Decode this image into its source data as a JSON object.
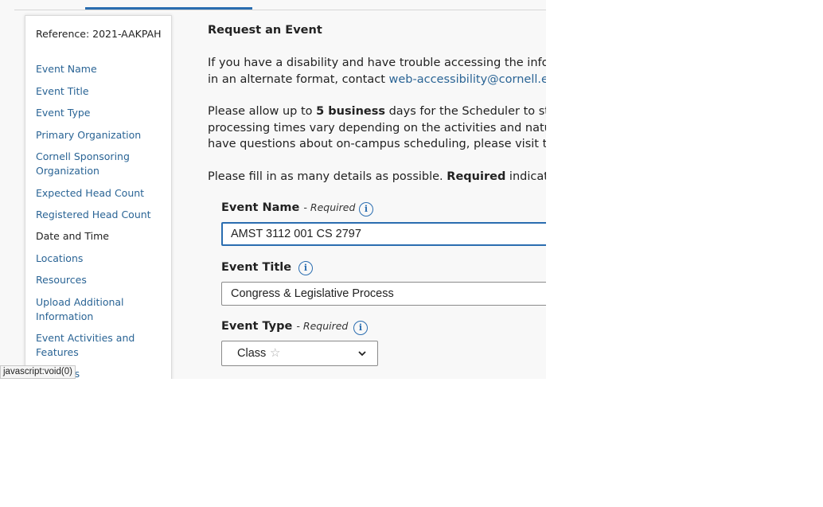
{
  "sidebar": {
    "reference": "Reference: 2021-AAKPAH",
    "items": [
      {
        "label": "Event Name"
      },
      {
        "label": "Event Title"
      },
      {
        "label": "Event Type"
      },
      {
        "label": "Primary Organization"
      },
      {
        "label": "Cornell Sponsoring Organization"
      },
      {
        "label": "Expected Head Count"
      },
      {
        "label": "Registered Head Count"
      },
      {
        "label": "Date and Time"
      },
      {
        "label": "Locations"
      },
      {
        "label": "Resources"
      },
      {
        "label": "Upload Additional Information"
      },
      {
        "label": "Event Activities and Features"
      },
      {
        "label": "Contacts"
      }
    ],
    "current_item": "Date and Time"
  },
  "main": {
    "heading": "Request an Event",
    "accessibility": {
      "line1": "If you have a disability and have trouble accessing the inform",
      "line2_prefix": "in an alternate format, contact ",
      "email_link": "web-accessibility@cornell.edu"
    },
    "processing": {
      "line1_prefix": "Please allow up to ",
      "line1_bold": "5 business",
      "line1_suffix": " days for the Scheduler to sta",
      "line2": "processing times vary depending on the activities and nature",
      "line3": "have questions about on-campus scheduling, please visit the"
    },
    "instructions": {
      "prefix": "Please fill in as many details as possible. ",
      "bold": "Required",
      "suffix": " indicates"
    }
  },
  "form": {
    "event_name": {
      "label": "Event Name",
      "required_text": "- Required",
      "value": "AMST 3112 001 CS 2797"
    },
    "event_title": {
      "label": "Event Title",
      "value": "Congress & Legislative Process"
    },
    "event_type": {
      "label": "Event Type",
      "required_text": "- Required",
      "selected": "Class"
    }
  },
  "status_bar": {
    "text": "javascript:void(0)"
  },
  "colors": {
    "link": "#2a6495",
    "accent": "#2a6db0",
    "background": "#f8f8f8"
  },
  "icons": [
    "info-icon",
    "star-icon",
    "chevron-down-icon"
  ]
}
